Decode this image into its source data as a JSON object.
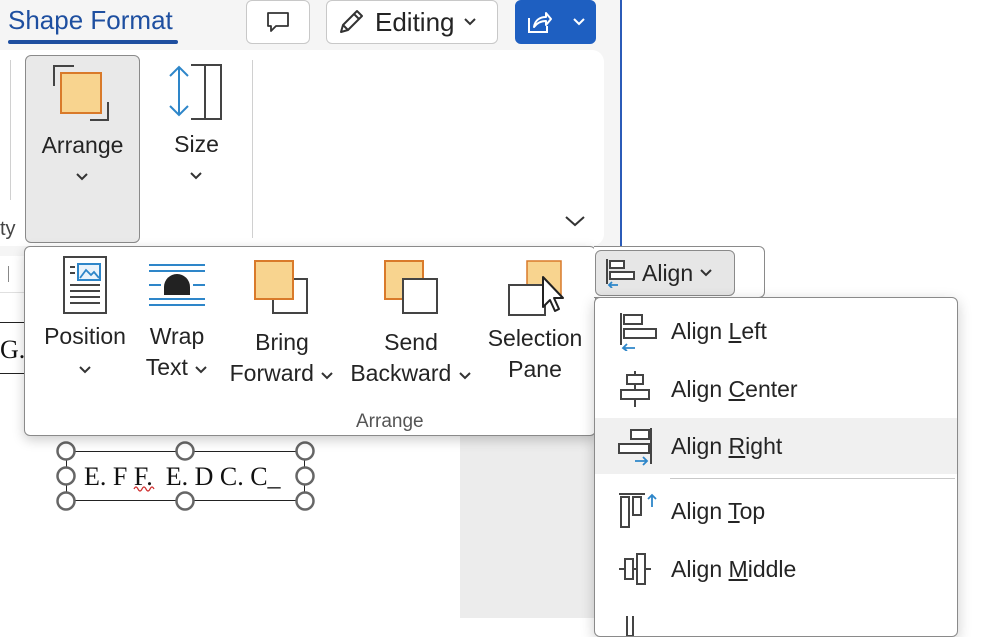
{
  "title_bar": {
    "tab_name": "Shape Format",
    "editing_label": "Editing"
  },
  "ribbon": {
    "arrange_label": "Arrange",
    "size_label": "Size",
    "partial_label": "ty"
  },
  "flyout": {
    "position": {
      "line1": "Position"
    },
    "wrap_text": {
      "line1": "Wrap",
      "line2": "Text"
    },
    "bring_forward": {
      "line1": "Bring",
      "line2": "Forward"
    },
    "send_backward": {
      "line1": "Send",
      "line2": "Backward"
    },
    "selection_pane": {
      "line1": "Selection",
      "line2": "Pane"
    },
    "group_label": "Arrange"
  },
  "align": {
    "button_label": "Align",
    "menu": [
      {
        "pre": "Align ",
        "accel": "L",
        "post": "eft"
      },
      {
        "pre": "Align ",
        "accel": "C",
        "post": "enter"
      },
      {
        "pre": "Align ",
        "accel": "R",
        "post": "ight"
      },
      {
        "pre": "Align ",
        "accel": "T",
        "post": "op"
      },
      {
        "pre": "Align ",
        "accel": "M",
        "post": "iddle"
      }
    ]
  },
  "document": {
    "partial_text": "G.",
    "textbox_text": "E. F F.  E. D C. C_"
  },
  "colors": {
    "accent": "#1e4fa0",
    "share_button": "#1e5fc1",
    "shape_fill": "#f8d48f",
    "shape_border": "#d97a2a",
    "icon_blue": "#2e86c9"
  }
}
